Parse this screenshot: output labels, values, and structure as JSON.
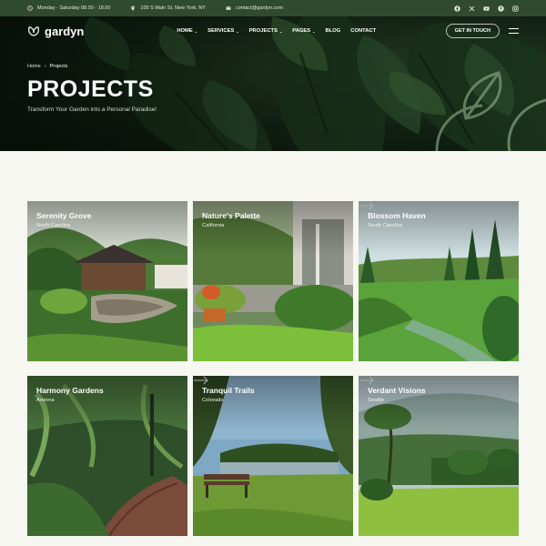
{
  "topbar": {
    "hours": "Monday - Saturday 08.00 - 18.00",
    "address": "100 S Main St, New York, NY",
    "email": "contact@gardyn.com",
    "social": [
      "facebook-icon",
      "x-icon",
      "youtube-icon",
      "pinterest-icon",
      "instagram-icon"
    ]
  },
  "nav": {
    "logo": "gardyn",
    "items": [
      {
        "label": "HOME",
        "caret": "⌄"
      },
      {
        "label": "SERVICES",
        "caret": "⌄"
      },
      {
        "label": "PROJECTS",
        "caret": "⌄"
      },
      {
        "label": "PAGES",
        "caret": "⌄"
      },
      {
        "label": "BLOG",
        "caret": ""
      },
      {
        "label": "CONTACT",
        "caret": ""
      }
    ],
    "cta": "GET IN TOUCH"
  },
  "breadcrumb": {
    "home": "Home",
    "sep": "›",
    "current": "Projects"
  },
  "hero": {
    "title": "PROJECTS",
    "subtitle": "Transform Your Garden into a Personal Paradise!"
  },
  "projects": [
    {
      "title": "Serenity Grove",
      "location": "North Carolina"
    },
    {
      "title": "Nature's Palette",
      "location": "California"
    },
    {
      "title": "Blossom Haven",
      "location": "South Carolina"
    },
    {
      "title": "Harmony Gardens",
      "location": "Arizona"
    },
    {
      "title": "Tranquil Trails",
      "location": "Colorado"
    },
    {
      "title": "Verdant Visions",
      "location": "Seattle"
    }
  ],
  "colors": {
    "topbar": "#2f4a2c",
    "page_bg": "#f5f7f0",
    "accent": "#8fb58a"
  }
}
